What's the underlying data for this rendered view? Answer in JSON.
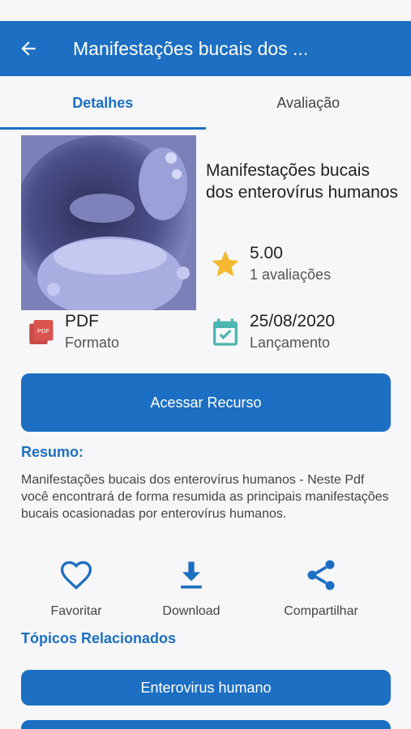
{
  "appbar": {
    "title": "Manifestações bucais dos ..."
  },
  "tabs": [
    {
      "label": "Detalhes",
      "active": true
    },
    {
      "label": "Avaliação",
      "active": false
    }
  ],
  "resource": {
    "title": "Manifestações bucais dos enterovírus humanos",
    "rating": "5.00",
    "rating_count": "1 avaliações",
    "format_value": "PDF",
    "format_label": "Formato",
    "release_value": "25/08/2020",
    "release_label": "Lançamento"
  },
  "access_button": "Acessar Recurso",
  "summary": {
    "title": "Resumo:",
    "text": "Manifestações bucais dos enterovírus humanos - Neste Pdf você encontrará de forma resumida as principais manifestações bucais ocasionadas por enterovírus humanos."
  },
  "actions": [
    {
      "label": "Favoritar",
      "icon": "heart-icon"
    },
    {
      "label": "Download",
      "icon": "download-icon"
    },
    {
      "label": "Compartilhar",
      "icon": "share-icon"
    }
  ],
  "related": {
    "title": "Tópicos Relacionados",
    "topics": [
      "Enterovirus humano"
    ]
  },
  "colors": {
    "primary": "#1c6fc2",
    "star": "#f5b82e",
    "calendar": "#4cb6b0",
    "pdf": "#d9534f"
  }
}
